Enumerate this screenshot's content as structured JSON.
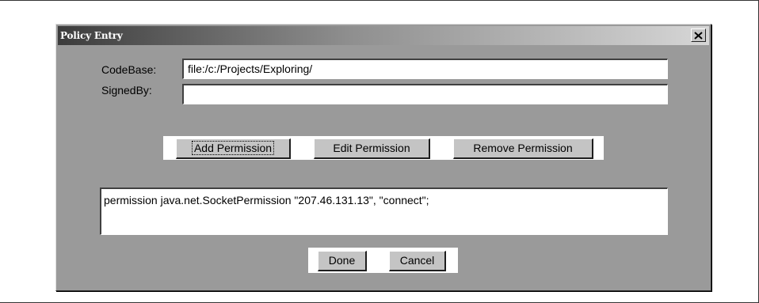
{
  "dialog": {
    "title": "Policy Entry",
    "close_icon": "close-x-icon"
  },
  "fields": {
    "codebase_label": "CodeBase:",
    "codebase_value": "file:/c:/Projects/Exploring/",
    "signedby_label": "SignedBy:",
    "signedby_value": ""
  },
  "permission_buttons": {
    "add": "Add Permission",
    "edit": "Edit Permission",
    "remove": "Remove Permission"
  },
  "permissions_list": {
    "text": "permission java.net.SocketPermission \"207.46.131.13\", \"connect\";"
  },
  "footer_buttons": {
    "done": "Done",
    "cancel": "Cancel"
  },
  "colors": {
    "window_bg": "#9a9a9a",
    "button_bg": "#c4c4c4",
    "field_bg": "#ffffff"
  }
}
